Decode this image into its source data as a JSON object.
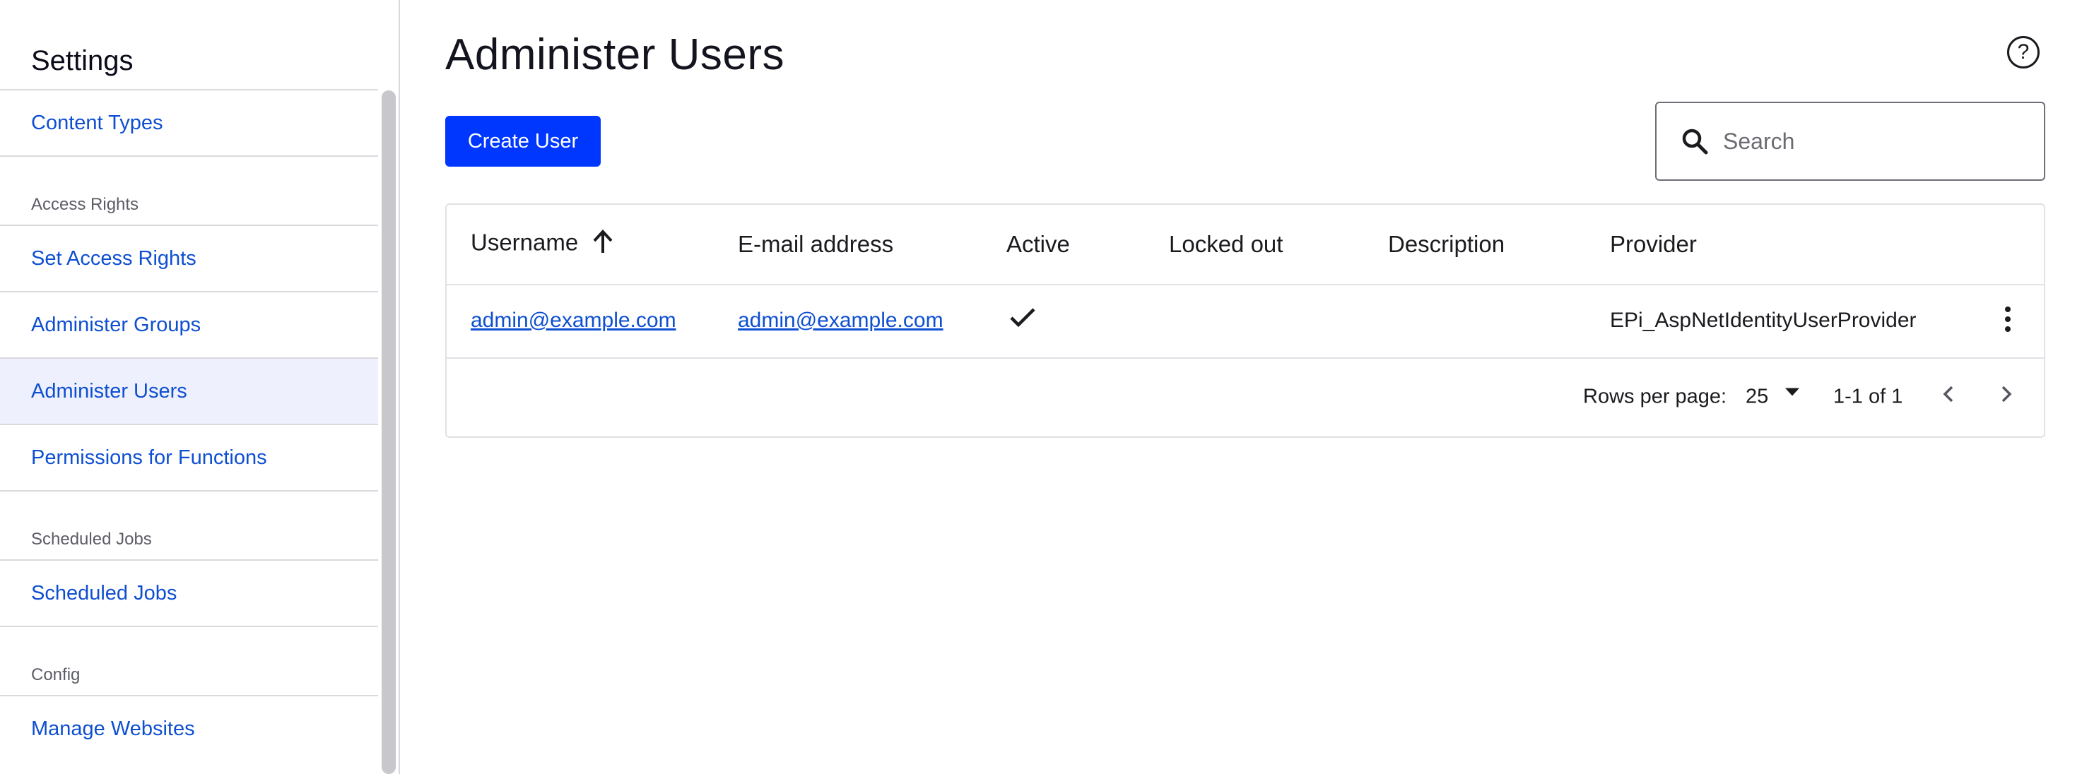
{
  "sidebar": {
    "title": "Settings",
    "items": [
      {
        "type": "link",
        "label": "Content Types"
      },
      {
        "type": "group",
        "label": "Access Rights"
      },
      {
        "type": "link",
        "label": "Set Access Rights"
      },
      {
        "type": "link",
        "label": "Administer Groups"
      },
      {
        "type": "link",
        "label": "Administer Users",
        "active": true
      },
      {
        "type": "link",
        "label": "Permissions for Functions"
      },
      {
        "type": "group",
        "label": "Scheduled Jobs"
      },
      {
        "type": "link",
        "label": "Scheduled Jobs"
      },
      {
        "type": "group",
        "label": "Config"
      },
      {
        "type": "link",
        "label": "Manage Websites"
      }
    ]
  },
  "main": {
    "title": "Administer Users",
    "help_icon": "question-circle-icon",
    "create_button": "Create User",
    "search": {
      "placeholder": "Search",
      "value": ""
    },
    "table": {
      "columns": [
        "Username",
        "E-mail address",
        "Active",
        "Locked out",
        "Description",
        "Provider"
      ],
      "sort_column": "Username",
      "sort_direction": "ascending",
      "rows": [
        {
          "username": "admin@example.com",
          "email": "admin@example.com",
          "active": true,
          "locked_out": "",
          "description": "",
          "provider": "EPi_AspNetIdentityUserProvider"
        }
      ],
      "footer": {
        "rows_per_page_label": "Rows per page:",
        "rows_per_page": "25",
        "range": "1-1 of 1"
      }
    }
  }
}
